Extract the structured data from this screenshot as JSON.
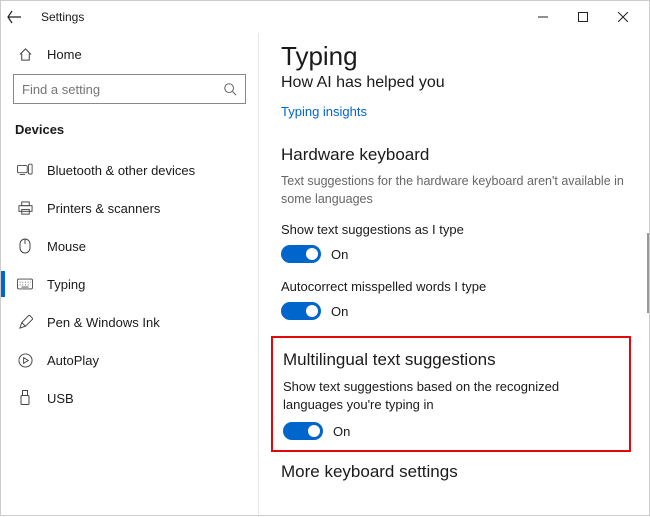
{
  "titlebar": {
    "title": "Settings"
  },
  "sidebar": {
    "home_label": "Home",
    "search_placeholder": "Find a setting",
    "category": "Devices",
    "items": [
      {
        "label": "Bluetooth & other devices"
      },
      {
        "label": "Printers & scanners"
      },
      {
        "label": "Mouse"
      },
      {
        "label": "Typing"
      },
      {
        "label": "Pen & Windows Ink"
      },
      {
        "label": "AutoPlay"
      },
      {
        "label": "USB"
      }
    ]
  },
  "content": {
    "heading": "Typing",
    "subtitle": "How AI has helped you",
    "link": "Typing insights",
    "hardware": {
      "title": "Hardware keyboard",
      "note": "Text suggestions for the hardware keyboard aren't available in some languages",
      "show_suggestions_label": "Show text suggestions as I type",
      "show_suggestions_state": "On",
      "autocorrect_label": "Autocorrect misspelled words I type",
      "autocorrect_state": "On"
    },
    "multilingual": {
      "title": "Multilingual text suggestions",
      "desc": "Show text suggestions based on the recognized languages you're typing in",
      "state": "On"
    },
    "more_title": "More keyboard settings"
  }
}
